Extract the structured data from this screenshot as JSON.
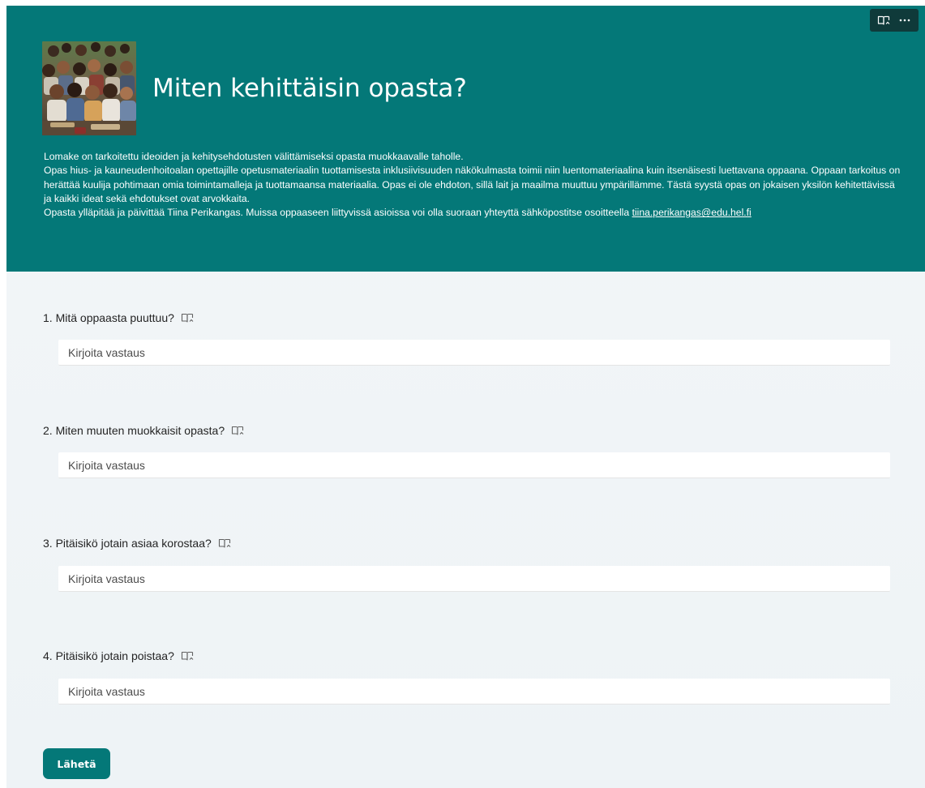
{
  "form": {
    "title": "Miten kehittäisin opasta?",
    "description": {
      "line1": "Lomake on tarkoitettu ideoiden ja kehitysehdotusten välittämiseksi opasta muokkaavalle taholle.",
      "line2": "Opas hius- ja kauneudenhoitoalan opettajille opetusmateriaalin tuottamisesta inklusiivisuuden näkökulmasta toimii niin luentomateriaalina kuin itsenäisesti luettavana oppaana. Oppaan tarkoitus on herättää kuulija pohtimaan omia toimintamalleja ja tuottamaansa materiaalia. Opas ei ole ehdoton, sillä lait ja maailma muuttuu ympärillämme. Tästä syystä opas on jokaisen yksilön kehitettävissä ja kaikki ideat sekä ehdotukset ovat arvokkaita.",
      "line3_prefix": "Opasta ylläpitää ja päivittää Tiina Perikangas. Muissa oppaaseen liittyvissä asioissa voi olla suoraan yhteyttä sähköpostitse osoitteella ",
      "email": "tiina.perikangas@edu.hel.fi"
    },
    "toolbar": {
      "icons": [
        "immersive-reader-icon",
        "more-options-icon"
      ],
      "more_label": "···"
    },
    "colors": {
      "header": "#047878",
      "toolbar": "#0f3a3a",
      "background": "#f3f6f8"
    },
    "questions": [
      {
        "label": "1. Mitä oppaasta puuttuu?",
        "placeholder": "Kirjoita vastaus",
        "value": ""
      },
      {
        "label": "2. Miten muuten muokkaisit opasta?",
        "placeholder": "Kirjoita vastaus",
        "value": ""
      },
      {
        "label": "3. Pitäisikö jotain asiaa korostaa?",
        "placeholder": "Kirjoita vastaus",
        "value": ""
      },
      {
        "label": "4. Pitäisikö jotain poistaa?",
        "placeholder": "Kirjoita vastaus",
        "value": ""
      }
    ],
    "submit_label": "Lähetä"
  }
}
